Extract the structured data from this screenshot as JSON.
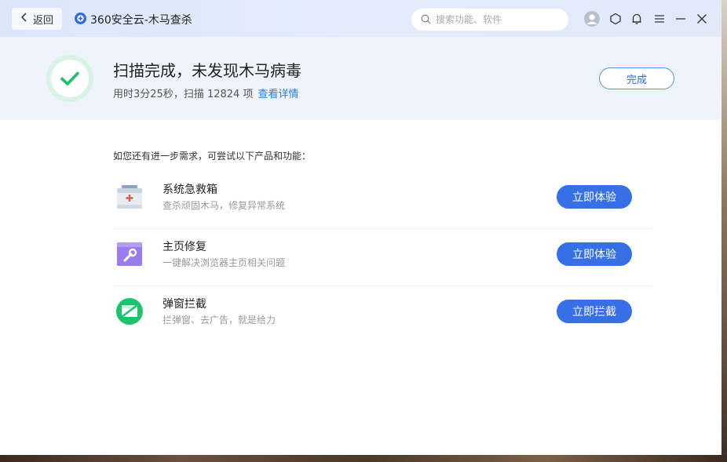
{
  "titlebar": {
    "back_label": "返回",
    "app_title": "360安全云-木马查杀",
    "search_placeholder": "搜索功能、软件"
  },
  "result": {
    "title": "扫描完成，未发现木马病毒",
    "summary": "用时3分25秒，扫描 12824 项",
    "detail_link": "查看详情",
    "done_label": "完成"
  },
  "suggestions": {
    "intro": "如您还有进一步需求，可尝试以下产品和功能：",
    "items": [
      {
        "name": "系统急救箱",
        "desc": "查杀顽固木马，修复异常系统",
        "button": "立即体验",
        "icon": "first-aid-kit-icon"
      },
      {
        "name": "主页修复",
        "desc": "一键解决浏览器主页相关问题",
        "button": "立即体验",
        "icon": "wrench-browser-icon"
      },
      {
        "name": "弹窗拦截",
        "desc": "拦弹窗、去广告，就是给力",
        "button": "立即拦截",
        "icon": "popup-block-icon"
      }
    ]
  },
  "colors": {
    "accent": "#3770e6",
    "success": "#1fbf6a",
    "header_bg": "#eef3fc"
  }
}
